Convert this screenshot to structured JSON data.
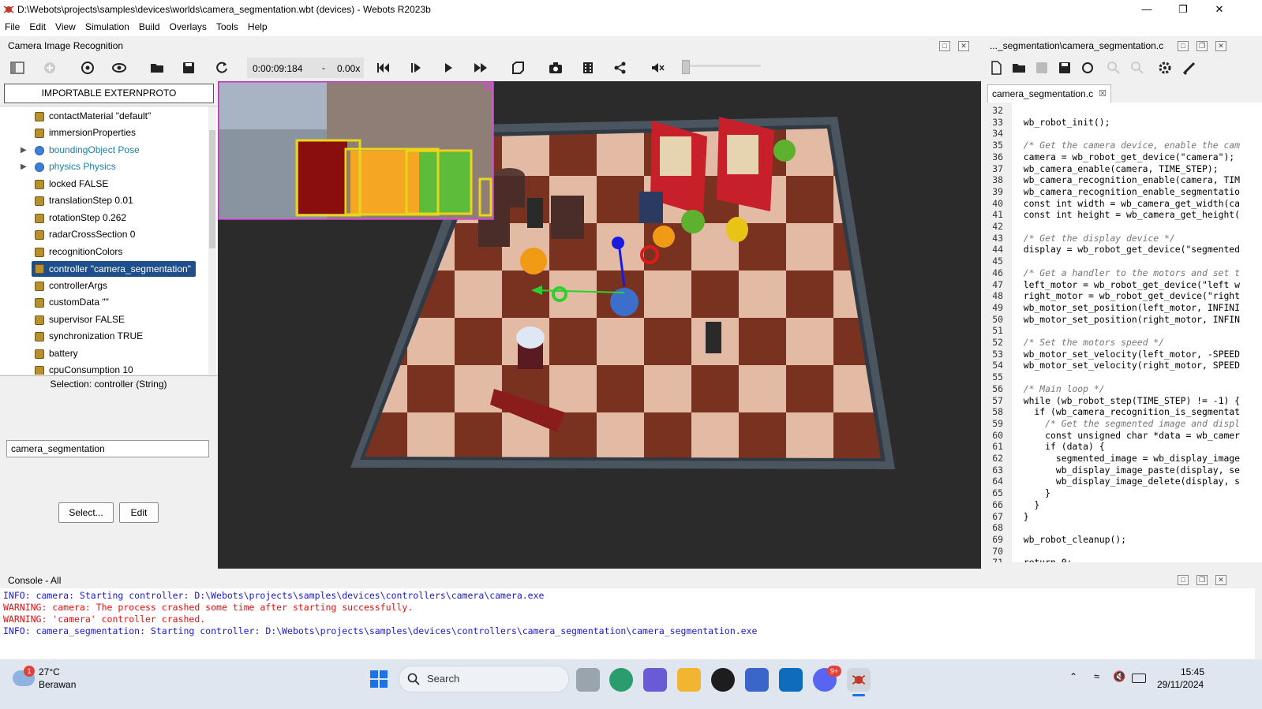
{
  "window": {
    "title": "D:\\Webots\\projects\\samples\\devices\\worlds\\camera_segmentation.wbt (devices) - Webots R2023b"
  },
  "menu": [
    "File",
    "Edit",
    "View",
    "Simulation",
    "Build",
    "Overlays",
    "Tools",
    "Help"
  ],
  "left_header": "Camera Image Recognition",
  "toolbar": {
    "time": "0:00:09:184",
    "dash": "-",
    "speed": "0.00x"
  },
  "scene_tree": {
    "import_button": "IMPORTABLE EXTERNPROTO",
    "rows": [
      {
        "label": "contactMaterial \"default\""
      },
      {
        "label": "immersionProperties"
      },
      {
        "label": "boundingObject Pose"
      },
      {
        "label": "physics Physics"
      },
      {
        "label": "locked FALSE"
      },
      {
        "label": "translationStep 0.01"
      },
      {
        "label": "rotationStep 0.262"
      },
      {
        "label": "radarCrossSection 0"
      },
      {
        "label": "recognitionColors"
      },
      {
        "label": "controller \"camera_segmentation\""
      },
      {
        "label": "controllerArgs"
      },
      {
        "label": "customData \"\""
      },
      {
        "label": "supervisor FALSE"
      },
      {
        "label": "synchronization TRUE"
      },
      {
        "label": "battery"
      },
      {
        "label": "cpuConsumption 10"
      }
    ]
  },
  "selection": {
    "title": "Selection: controller (String)",
    "value": "camera_segmentation",
    "select_button": "Select...",
    "edit_button": "Edit"
  },
  "editor": {
    "header": "..._segmentation\\camera_segmentation.c",
    "tab": "camera_segmentation.c",
    "lines": [
      {
        "n": "32",
        "t": ""
      },
      {
        "n": "33",
        "t": "  wb_robot_init();"
      },
      {
        "n": "34",
        "t": ""
      },
      {
        "n": "35",
        "t": "  /* Get the camera device, enable the cam"
      },
      {
        "n": "36",
        "t": "  camera = wb_robot_get_device(\"camera\");"
      },
      {
        "n": "37",
        "t": "  wb_camera_enable(camera, TIME_STEP);"
      },
      {
        "n": "38",
        "t": "  wb_camera_recognition_enable(camera, TIM"
      },
      {
        "n": "39",
        "t": "  wb_camera_recognition_enable_segmentatio"
      },
      {
        "n": "40",
        "t": "  const int width = wb_camera_get_width(ca"
      },
      {
        "n": "41",
        "t": "  const int height = wb_camera_get_height("
      },
      {
        "n": "42",
        "t": ""
      },
      {
        "n": "43",
        "t": "  /* Get the display device */"
      },
      {
        "n": "44",
        "t": "  display = wb_robot_get_device(\"segmented"
      },
      {
        "n": "45",
        "t": ""
      },
      {
        "n": "46",
        "t": "  /* Get a handler to the motors and set t"
      },
      {
        "n": "47",
        "t": "  left_motor = wb_robot_get_device(\"left w"
      },
      {
        "n": "48",
        "t": "  right_motor = wb_robot_get_device(\"right"
      },
      {
        "n": "49",
        "t": "  wb_motor_set_position(left_motor, INFINI"
      },
      {
        "n": "50",
        "t": "  wb_motor_set_position(right_motor, INFIN"
      },
      {
        "n": "51",
        "t": ""
      },
      {
        "n": "52",
        "t": "  /* Set the motors speed */"
      },
      {
        "n": "53",
        "t": "  wb_motor_set_velocity(left_motor, -SPEED"
      },
      {
        "n": "54",
        "t": "  wb_motor_set_velocity(right_motor, SPEED"
      },
      {
        "n": "55",
        "t": ""
      },
      {
        "n": "56",
        "t": "  /* Main loop */"
      },
      {
        "n": "57",
        "t": "  while (wb_robot_step(TIME_STEP) != -1) {"
      },
      {
        "n": "58",
        "t": "    if (wb_camera_recognition_is_segmentat"
      },
      {
        "n": "59",
        "t": "      /* Get the segmented image and displ"
      },
      {
        "n": "60",
        "t": "      const unsigned char *data = wb_camer"
      },
      {
        "n": "61",
        "t": "      if (data) {"
      },
      {
        "n": "62",
        "t": "        segmented_image = wb_display_image"
      },
      {
        "n": "63",
        "t": "        wb_display_image_paste(display, se"
      },
      {
        "n": "64",
        "t": "        wb_display_image_delete(display, s"
      },
      {
        "n": "65",
        "t": "      }"
      },
      {
        "n": "66",
        "t": "    }"
      },
      {
        "n": "67",
        "t": "  }"
      },
      {
        "n": "68",
        "t": ""
      },
      {
        "n": "69",
        "t": "  wb_robot_cleanup();"
      },
      {
        "n": "70",
        "t": ""
      },
      {
        "n": "71",
        "t": "  return 0;"
      }
    ]
  },
  "console": {
    "title": "Console - All",
    "lines": [
      {
        "text": "INFO: camera: Starting controller: D:\\Webots\\projects\\samples\\devices\\controllers\\camera\\camera.exe",
        "color": "#1a1ad0"
      },
      {
        "text": "WARNING: camera: The process crashed some time after starting successfully.",
        "color": "#e01010"
      },
      {
        "text": "WARNING: 'camera' controller crashed.",
        "color": "#e01010"
      },
      {
        "text": "INFO: camera_segmentation: Starting controller: D:\\Webots\\projects\\samples\\devices\\controllers\\camera_segmentation\\camera_segmentation.exe",
        "color": "#1a1ad0"
      }
    ]
  },
  "taskbar": {
    "weather_temp": "27°C",
    "weather_desc": "Berawan",
    "weather_badge": "1",
    "search": "Search",
    "discord_badge": "9+",
    "time": "15:45",
    "date": "29/11/2024"
  }
}
